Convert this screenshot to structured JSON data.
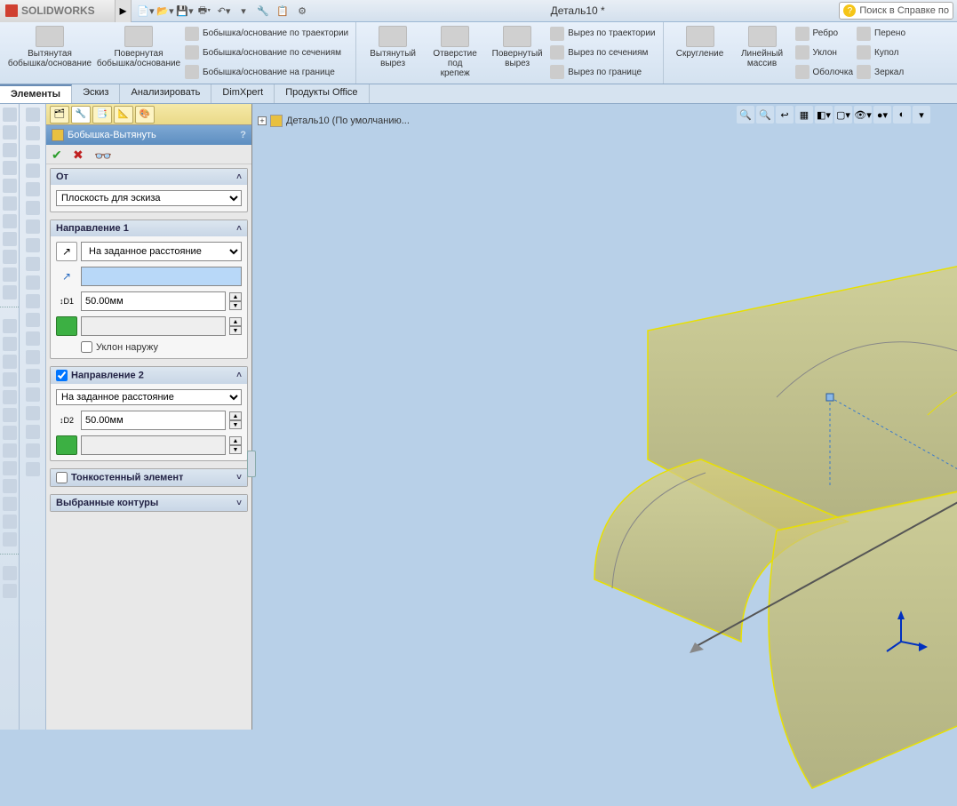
{
  "app": {
    "name": "SOLIDWORKS",
    "doc_title": "Деталь10 *",
    "search_placeholder": "Поиск в Справке по"
  },
  "ribbon": {
    "g1": {
      "b1": "Вытянутая\nбобышка/основание",
      "b2": "Повернутая\nбобышка/основание",
      "s1": "Бобышка/основание по траектории",
      "s2": "Бобышка/основание по сечениям",
      "s3": "Бобышка/основание на границе"
    },
    "g2": {
      "b1": "Вытянутый\nвырез",
      "b2": "Отверстие\nпод\nкрепеж",
      "b3": "Повернутый\nвырез",
      "s1": "Вырез по траектории",
      "s2": "Вырез по сечениям",
      "s3": "Вырез по границе"
    },
    "g3": {
      "b1": "Скругление",
      "b2": "Линейный\nмассив",
      "s1": "Ребро",
      "s2": "Уклон",
      "s3": "Оболочка",
      "s4": "Перено",
      "s5": "Купол",
      "s6": "Зеркал"
    }
  },
  "tabs": [
    "Элементы",
    "Эскиз",
    "Анализировать",
    "DimXpert",
    "Продукты Office"
  ],
  "feature": {
    "title": "Бобышка-Вытянуть",
    "from": {
      "label": "От",
      "option": "Плоскость для эскиза"
    },
    "dir1": {
      "label": "Направление 1",
      "end": "На заданное расстояние",
      "dist": "50.00мм",
      "draft_out": "Уклон наружу"
    },
    "dir2": {
      "label": "Направление 2",
      "end": "На заданное расстояние",
      "dist": "50.00мм"
    },
    "thin": "Тонкостенный элемент",
    "contours": "Выбранные контуры"
  },
  "tree": {
    "label": "Деталь10  (По умолчанию..."
  }
}
